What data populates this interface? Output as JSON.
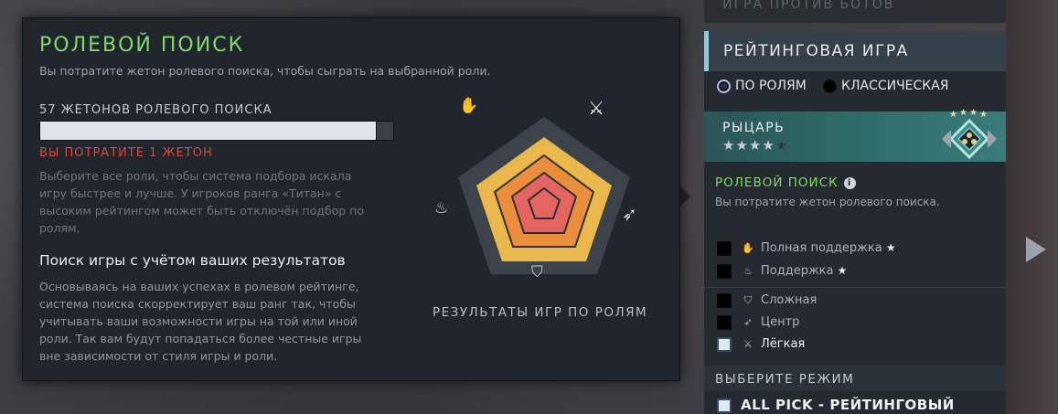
{
  "tooltip": {
    "title": "РОЛЕВОЙ ПОИСК",
    "subtitle": "Вы потратите жетон ролевого поиска, чтобы сыграть на выбранной роли.",
    "tokens_label": "57 ЖЕТОНОВ РОЛЕВОГО ПОИСКА",
    "spend_warning": "ВЫ ПОТРАТИТЕ 1 ЖЕТОН",
    "description": "Выберите все роли, чтобы система подбора искала игру быстрее и лучше. У игроков ранга «Титан» с высоким рейтингом может быть отключён подбор по ролям.",
    "heading": "Поиск игры с учётом ваших результатов",
    "body": "Основываясь на ваших успехах в ролевом рейтинге, система поиска скорректирует ваш ранг так, чтобы учитывать ваши возможности игры на той или иной роли. Так вам будут попадаться более честные игры вне зависимости от стиля игры и роли.",
    "radar_caption": "РЕЗУЛЬТАТЫ ИГР ПО РОЛЯМ",
    "radar_icons": [
      "hard-support-icon",
      "carry-sword-icon",
      "mid-bow-icon",
      "offlane-shield-icon",
      "soft-support-icon"
    ]
  },
  "right_panel": {
    "top_item": "ИГРА ПРОТИВ БОТОВ",
    "mode_title": "РЕЙТИНГОВАЯ ИГРА",
    "radio_roles": "ПО РОЛЯМ",
    "radio_classic": "КЛАССИЧЕСКАЯ",
    "rank_name": "РЫЦАРЬ",
    "rank_stars": "★★★★",
    "rank_star_empty": "★",
    "role_search_title": "РОЛЕВОЙ ПОИСК",
    "role_search_desc": "Вы потратите жетон ролевого поиска.",
    "roles": [
      {
        "label": "Полная поддержка",
        "star": "★",
        "checked": false
      },
      {
        "label": "Поддержка",
        "star": "★",
        "checked": false
      },
      {
        "label": "Сложная",
        "star": "",
        "checked": false
      },
      {
        "label": "Центр",
        "star": "",
        "checked": false
      },
      {
        "label": "Лёгкая",
        "star": "",
        "checked": true
      }
    ],
    "choose_mode_label": "ВЫБЕРИТЕ РЕЖИМ",
    "all_pick": "ALL PICK - РЕЙТИНГОВЫЙ"
  },
  "colors": {
    "accent_green": "#7fd96a",
    "warning_red": "#d8493b",
    "panel_bg": "#21262c",
    "rank_teal": "#2e6e6c"
  }
}
